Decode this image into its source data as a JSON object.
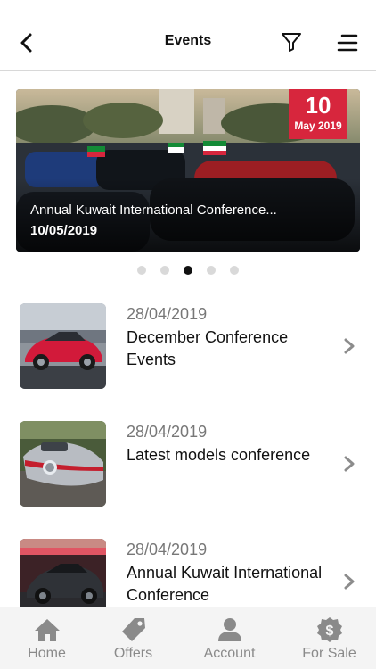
{
  "header": {
    "title": "Events",
    "back_icon": "back-arrow-icon",
    "filter_icon": "filter-icon",
    "menu_icon": "menu-icon"
  },
  "banner": {
    "day": "10",
    "month_year": "May 2019",
    "title": "Annual Kuwait International Conference...",
    "date": "10/05/2019",
    "badge_color": "#d7263d"
  },
  "carousel": {
    "total": 5,
    "active_index": 2
  },
  "events": [
    {
      "date": "28/04/2019",
      "title": "December Conference Events"
    },
    {
      "date": "28/04/2019",
      "title": "Latest models conference"
    },
    {
      "date": "28/04/2019",
      "title": "Annual Kuwait International Conference"
    }
  ],
  "tabbar": {
    "items": [
      {
        "label": "Home",
        "icon": "home-icon"
      },
      {
        "label": "Offers",
        "icon": "tag-icon"
      },
      {
        "label": "Account",
        "icon": "user-icon"
      },
      {
        "label": "For Sale",
        "icon": "dollar-icon"
      }
    ]
  }
}
